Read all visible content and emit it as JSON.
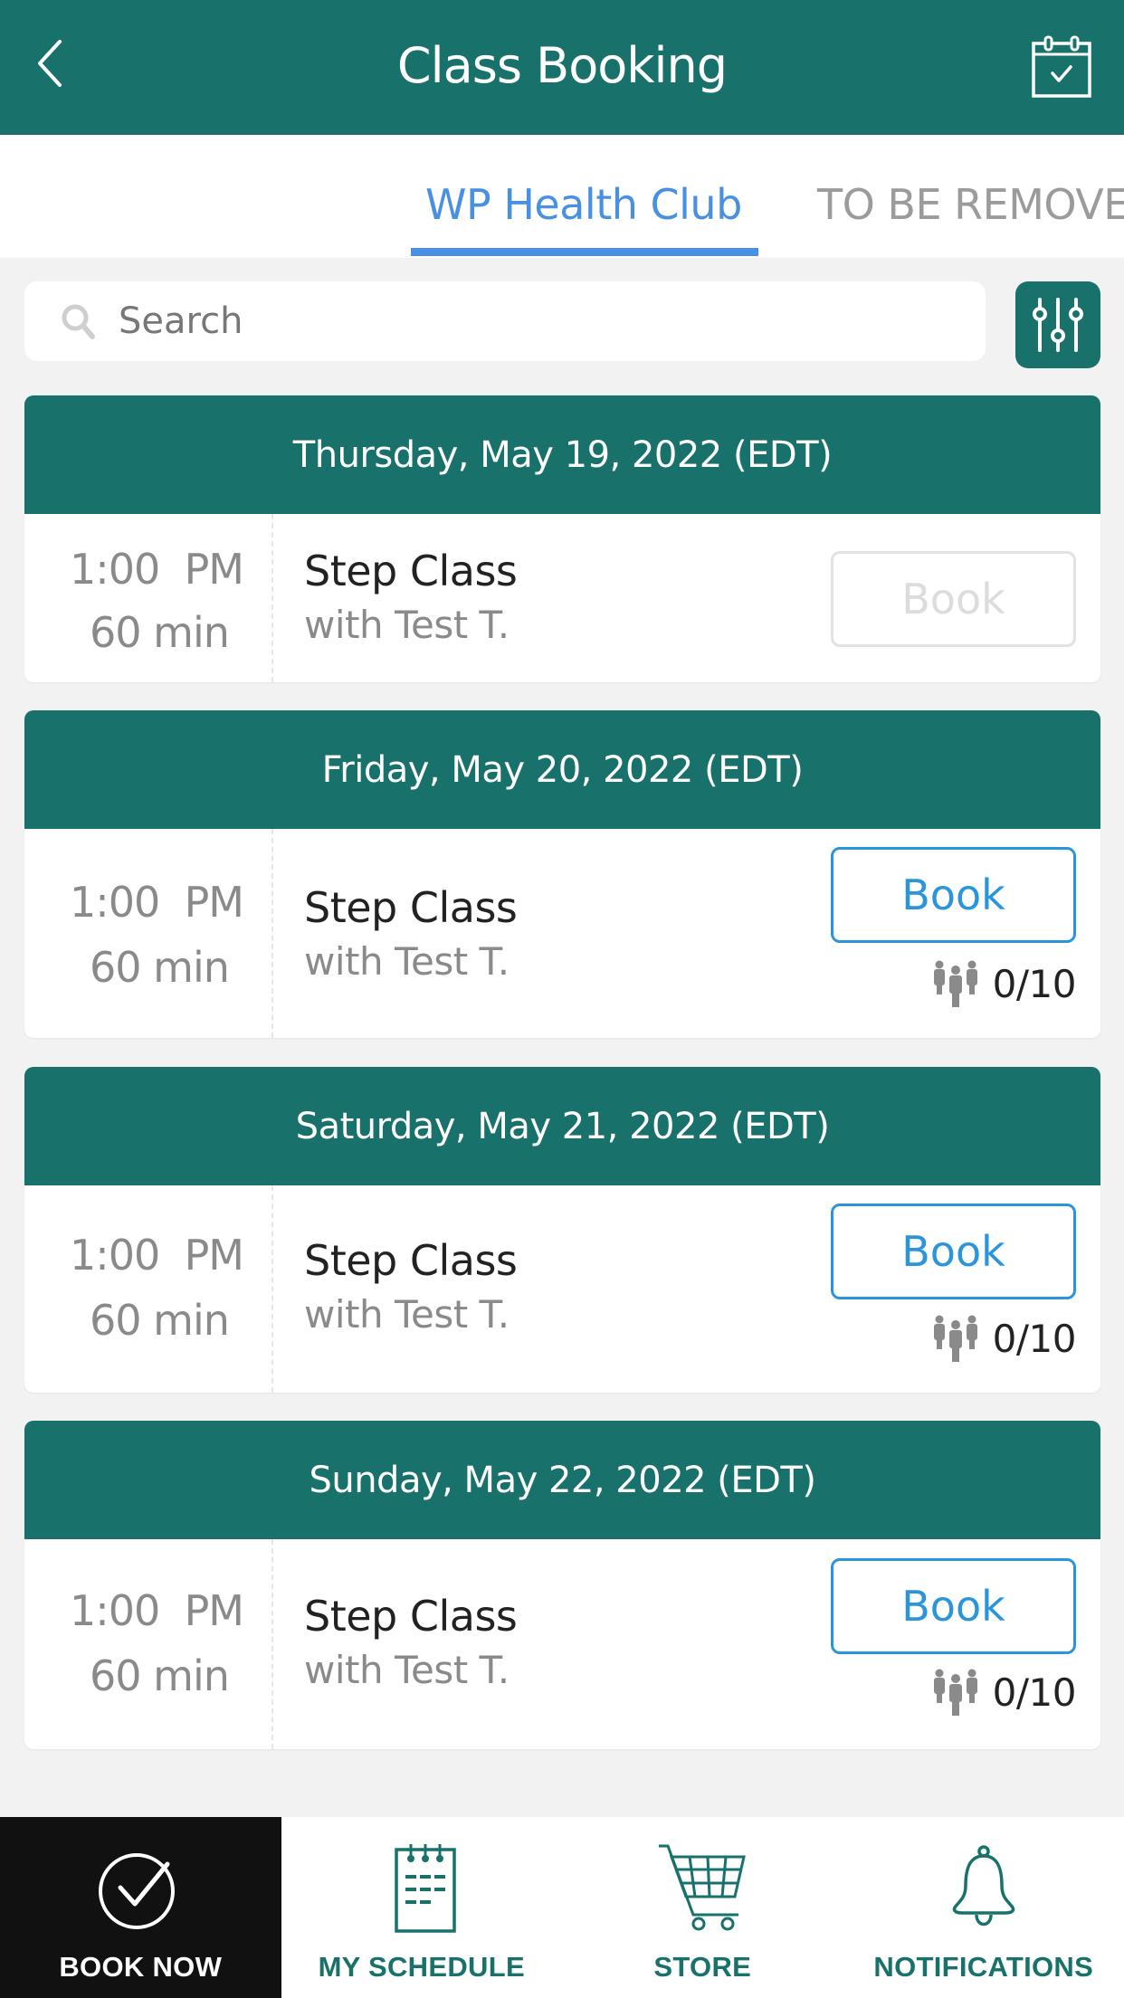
{
  "header": {
    "title": "Class Booking",
    "back_icon": "chevron-left-icon",
    "right_icon": "calendar-check-icon"
  },
  "tabs": [
    {
      "label": "WP Health Club",
      "active": true
    },
    {
      "label": "TO BE REMOVE",
      "active": false
    }
  ],
  "search": {
    "placeholder": "Search",
    "value": "",
    "icon": "search-icon",
    "filter_icon": "sliders-icon"
  },
  "days": [
    {
      "date_label": "Thursday, May 19, 2022 (EDT)",
      "classes": [
        {
          "time": "1:00",
          "ampm": "PM",
          "duration": "60 min",
          "name": "Step Class",
          "instructor": "with Test T.",
          "book_label": "Book",
          "book_enabled": false,
          "capacity": ""
        }
      ]
    },
    {
      "date_label": "Friday, May 20, 2022 (EDT)",
      "classes": [
        {
          "time": "1:00",
          "ampm": "PM",
          "duration": "60 min",
          "name": "Step Class",
          "instructor": "with Test T.",
          "book_label": "Book",
          "book_enabled": true,
          "capacity": "0/10"
        }
      ]
    },
    {
      "date_label": "Saturday, May 21, 2022 (EDT)",
      "classes": [
        {
          "time": "1:00",
          "ampm": "PM",
          "duration": "60 min",
          "name": "Step Class",
          "instructor": "with Test T.",
          "book_label": "Book",
          "book_enabled": true,
          "capacity": "0/10"
        }
      ]
    },
    {
      "date_label": "Sunday, May 22, 2022 (EDT)",
      "classes": [
        {
          "time": "1:00",
          "ampm": "PM",
          "duration": "60 min",
          "name": "Step Class",
          "instructor": "with Test T.",
          "book_label": "Book",
          "book_enabled": true,
          "capacity": "0/10"
        }
      ]
    }
  ],
  "bottom_nav": [
    {
      "label": "BOOK NOW",
      "icon": "check-circle-icon",
      "active": true
    },
    {
      "label": "MY SCHEDULE",
      "icon": "notepad-icon",
      "active": false
    },
    {
      "label": "STORE",
      "icon": "shopping-cart-icon",
      "active": false
    },
    {
      "label": "NOTIFICATIONS",
      "icon": "bell-icon",
      "active": false
    }
  ],
  "colors": {
    "primary": "#19716b",
    "accent_blue": "#4a90e2",
    "book_blue": "#2b95dc",
    "background": "#f2f2f2",
    "nav_active_bg": "#111111"
  }
}
